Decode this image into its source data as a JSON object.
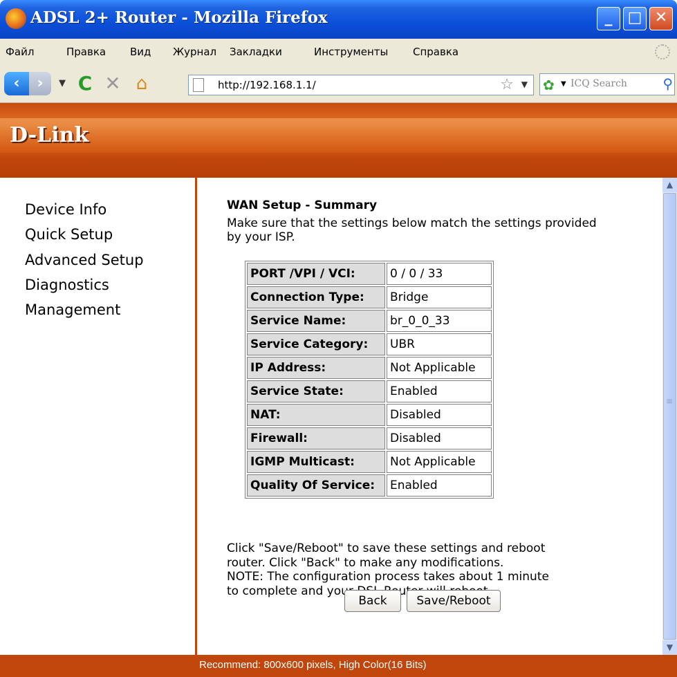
{
  "window": {
    "title": "ADSL 2+ Router - Mozilla Firefox"
  },
  "menu": {
    "items": [
      "Файл",
      "Правка",
      "Вид",
      "Журнал",
      "Закладки",
      "Инструменты",
      "Справка"
    ]
  },
  "navbar": {
    "url": "http://192.168.1.1/",
    "search_placeholder": "ICQ Search"
  },
  "header": {
    "logo": "D-Link"
  },
  "sidebar": {
    "items": [
      "Device Info",
      "Quick Setup",
      "Advanced Setup",
      "Diagnostics",
      "Management"
    ]
  },
  "main": {
    "heading": "WAN Setup - Summary",
    "intro": "Make sure that the settings below match the settings provided by your ISP.",
    "rows": [
      {
        "label": "PORT /VPI / VCI:",
        "value": "0 / 0 / 33"
      },
      {
        "label": "Connection Type:",
        "value": "Bridge"
      },
      {
        "label": "Service Name:",
        "value": "br_0_0_33"
      },
      {
        "label": "Service Category:",
        "value": "UBR"
      },
      {
        "label": "IP Address:",
        "value": "Not Applicable"
      },
      {
        "label": "Service State:",
        "value": "Enabled"
      },
      {
        "label": "NAT:",
        "value": "Disabled"
      },
      {
        "label": "Firewall:",
        "value": "Disabled"
      },
      {
        "label": "IGMP Multicast:",
        "value": "Not Applicable"
      },
      {
        "label": "Quality Of Service:",
        "value": "Enabled"
      }
    ],
    "note_lines": [
      "Click \"Save/Reboot\" to save these settings and reboot",
      "router. Click \"Back\" to make any modifications.",
      "NOTE: The configuration process takes about 1 minute",
      "to complete and your DSL Router will reboot."
    ],
    "back_label": "Back",
    "save_label": "Save/Reboot"
  },
  "footer": {
    "text": "Recommend: 800x600 pixels, High Color(16 Bits)"
  }
}
